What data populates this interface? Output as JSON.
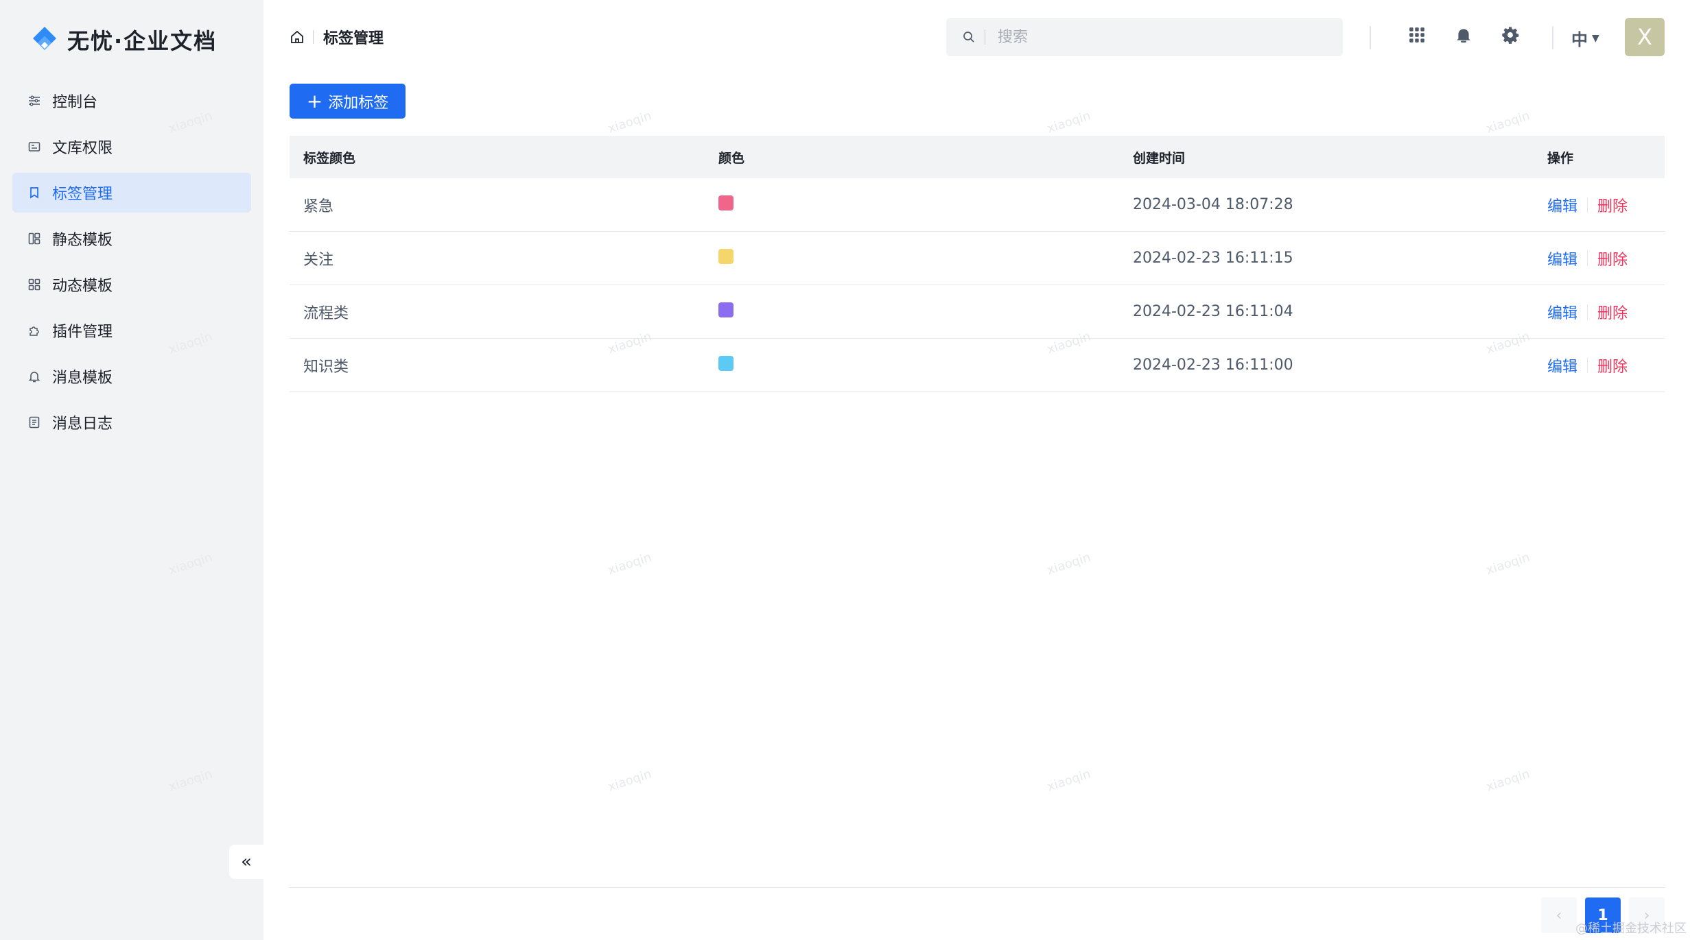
{
  "brand": {
    "name": "无忧·企业文档",
    "accent": "#1f6bf2"
  },
  "sidebar": {
    "items": [
      {
        "label": "控制台",
        "icon": "sliders-icon",
        "active": false
      },
      {
        "label": "文库权限",
        "icon": "library-icon",
        "active": false
      },
      {
        "label": "标签管理",
        "icon": "bookmark-icon",
        "active": true
      },
      {
        "label": "静态模板",
        "icon": "layout-icon",
        "active": false
      },
      {
        "label": "动态模板",
        "icon": "grid-icon",
        "active": false
      },
      {
        "label": "插件管理",
        "icon": "puzzle-icon",
        "active": false
      },
      {
        "label": "消息模板",
        "icon": "bell-icon",
        "active": false
      },
      {
        "label": "消息日志",
        "icon": "file-log-icon",
        "active": false
      }
    ],
    "collapse_label": "«"
  },
  "header": {
    "breadcrumb": "标签管理",
    "search_placeholder": "搜索",
    "lang": "中",
    "avatar_initial": "X"
  },
  "toolbar": {
    "add_label": "添加标签"
  },
  "table": {
    "columns": [
      "标签颜色",
      "颜色",
      "创建时间",
      "操作"
    ],
    "rows": [
      {
        "name": "紧急",
        "color": "#f0668a",
        "created": "2024-03-04 18:07:28"
      },
      {
        "name": "关注",
        "color": "#f5d66b",
        "created": "2024-02-23 16:11:15"
      },
      {
        "name": "流程类",
        "color": "#8c6cf0",
        "created": "2024-02-23 16:11:04"
      },
      {
        "name": "知识类",
        "color": "#5ccaf5",
        "created": "2024-02-23 16:11:00"
      }
    ],
    "edit_label": "编辑",
    "delete_label": "删除"
  },
  "pagination": {
    "prev": "‹",
    "current": "1",
    "next": "›"
  },
  "watermark": {
    "text": "xiaoqin",
    "corner": "@稀土掘金技术社区"
  }
}
